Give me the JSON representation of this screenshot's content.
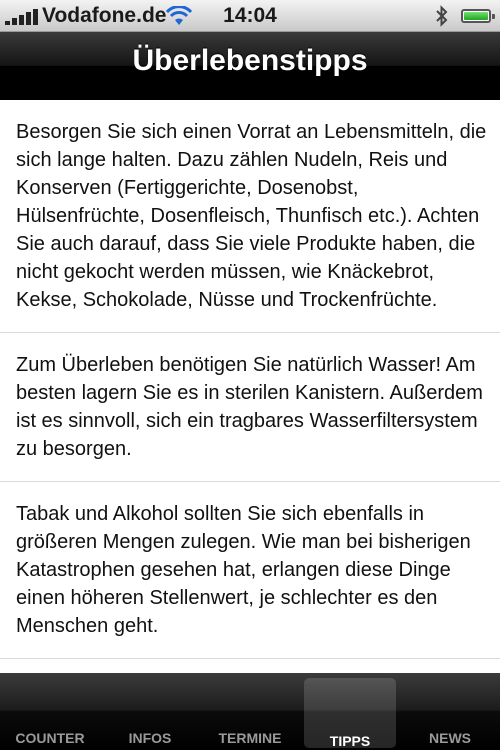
{
  "status": {
    "carrier": "Vodafone.de",
    "time": "14:04",
    "icons": [
      "signal-icon",
      "wifi-icon",
      "bluetooth-icon",
      "battery-icon"
    ]
  },
  "header": {
    "title": "Überlebenstipps"
  },
  "tips": [
    "Besorgen Sie sich einen Vorrat an Lebensmitteln, die sich lange halten. Dazu zählen Nudeln, Reis und Konserven (Fertiggerichte, Dosenobst, Hülsenfrüchte, Dosenfleisch, Thunfisch etc.). Achten Sie auch darauf, dass Sie viele Produkte haben, die nicht gekocht werden müssen, wie Knäckebrot, Kekse, Schokolade, Nüsse und Trockenfrüchte.",
    "Zum Überleben benötigen Sie natürlich Wasser! Am besten lagern Sie es in sterilen Kanistern. Außerdem ist es sinnvoll, sich ein tragbares Wasserfiltersystem zu besorgen.",
    "Tabak und Alkohol sollten Sie sich ebenfalls in größeren Mengen zulegen. Wie man bei bisherigen Katastrophen gesehen hat, erlangen diese Dinge einen höheren Stellenwert, je schlechter es den Menschen geht."
  ],
  "tabbar": {
    "tabs": [
      {
        "label": "COUNTER"
      },
      {
        "label": "INFOS"
      },
      {
        "label": "TERMINE"
      },
      {
        "label": "TIPPS"
      },
      {
        "label": "NEWS"
      }
    ],
    "active": "TIPPS"
  },
  "colors": {
    "navbar": "#000000",
    "active_tab_text": "#ffffff",
    "inactive_tab_text": "#9a9a9a"
  }
}
